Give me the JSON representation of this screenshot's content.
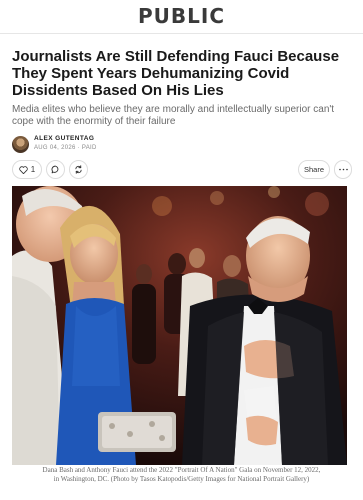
{
  "site": {
    "name": "PUBLIC"
  },
  "article": {
    "title": "Journalists Are Still Defending Fauci Because They Spent Years Dehumanizing Covid Dissidents Based On His Lies",
    "subtitle": "Media elites who believe they are morally and intellectually superior can't cope with the enormity of their failure",
    "author": "ALEX GUTENTAG",
    "meta": "AUG 04, 2026 · PAID"
  },
  "actions": {
    "like_count": "1",
    "share_label": "Share",
    "icons": [
      "heart-icon",
      "comment-icon",
      "restack-icon",
      "more-icon"
    ]
  },
  "photo": {
    "caption": "Dana Bash and Anthony Fauci attend the 2022 \"Portrait Of A Nation\" Gala on November 12, 2022, in Washington, DC. (Photo by Tasos Katopodis/Getty Images for National Portrait Gallery)"
  },
  "colors": {
    "text": "#1a1a1a",
    "muted": "#6b6b6b",
    "border": "#dcdcdc",
    "dress": "#1f57b8"
  }
}
